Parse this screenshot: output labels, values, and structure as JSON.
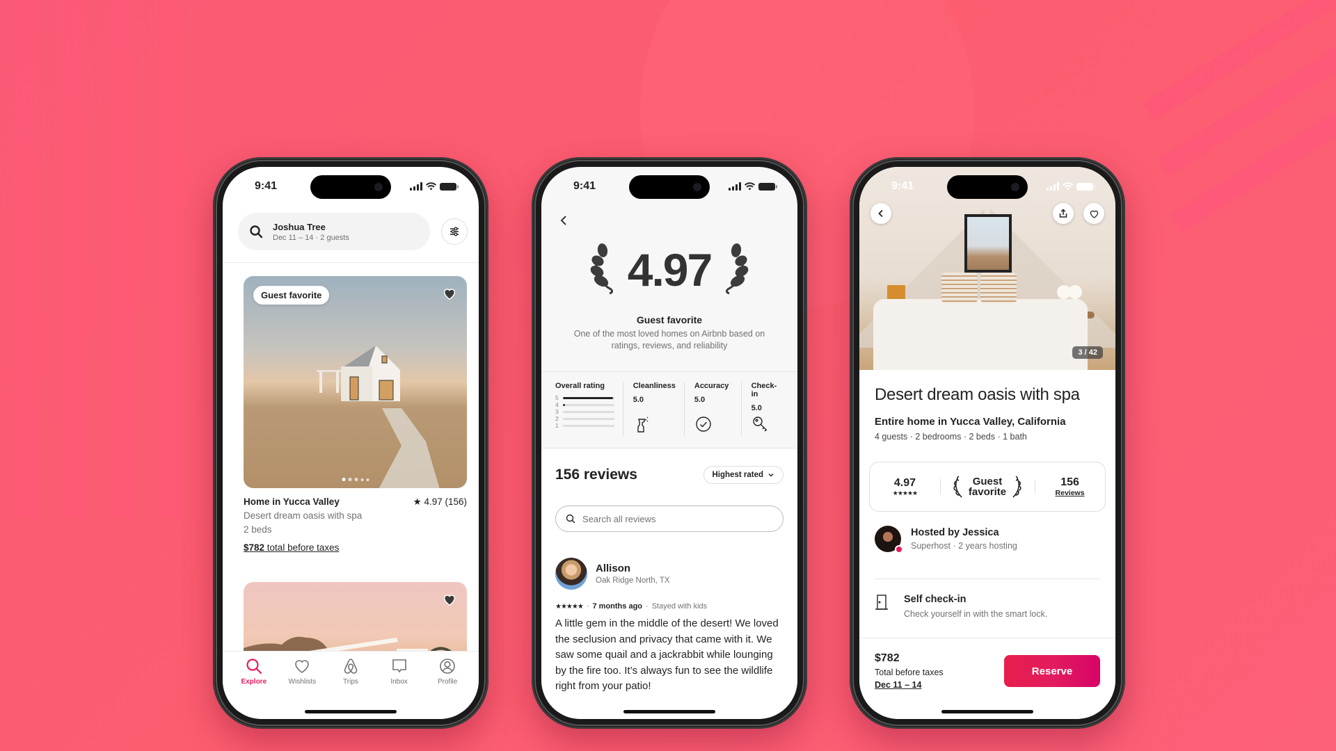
{
  "colors": {
    "brand": "#e31c5f",
    "background": "#fd5c73",
    "text": "#222222",
    "muted": "#717171"
  },
  "phones": {
    "explore": {
      "status_time": "9:41",
      "search": {
        "location": "Joshua Tree",
        "details": "Dec 11 – 14 · 2 guests"
      },
      "listings": [
        {
          "badge": "Guest favorite",
          "title": "Home in Yucca Valley",
          "rating": "★ 4.97 (156)",
          "description": "Desert dream oasis with spa",
          "beds": "2 beds",
          "price": "$782",
          "price_suffix": " total before taxes",
          "photo_index": 1,
          "photo_dots": 5,
          "favorited": true
        },
        {
          "favorited": true
        }
      ],
      "tabs": [
        {
          "label": "Explore",
          "icon": "search-icon",
          "active": true
        },
        {
          "label": "Wishlists",
          "icon": "heart-icon",
          "active": false
        },
        {
          "label": "Trips",
          "icon": "airbnb-logo-icon",
          "active": false
        },
        {
          "label": "Inbox",
          "icon": "message-icon",
          "active": false
        },
        {
          "label": "Profile",
          "icon": "profile-icon",
          "active": false
        }
      ]
    },
    "reviews": {
      "status_time": "9:41",
      "rating": "4.97",
      "guest_favorite_title": "Guest favorite",
      "guest_favorite_desc": "One of the most loved homes on Airbnb based on ratings, reviews, and reliability",
      "overall": {
        "label": "Overall rating",
        "distribution": [
          {
            "stars": "5",
            "fraction": 0.97
          },
          {
            "stars": "4",
            "fraction": 0.03
          },
          {
            "stars": "3",
            "fraction": 0
          },
          {
            "stars": "2",
            "fraction": 0
          },
          {
            "stars": "1",
            "fraction": 0
          }
        ]
      },
      "categories": [
        {
          "name": "Cleanliness",
          "value": "5.0",
          "icon": "spray-bottle-icon"
        },
        {
          "name": "Accuracy",
          "value": "5.0",
          "icon": "check-circle-icon"
        },
        {
          "name": "Check-in",
          "value": "5.0",
          "icon": "key-icon"
        }
      ],
      "reviews_count": "156 reviews",
      "sort_label": "Highest rated",
      "search_placeholder": "Search all reviews",
      "review": {
        "name": "Allison",
        "location": "Oak Ridge North, TX",
        "stars": "★★★★★",
        "when": "7 months ago",
        "context": "Stayed with kids",
        "text": "A little gem in the middle of the desert! We loved the seclusion and privacy that came with it. We saw some quail and a jackrabbit while lounging by the fire too. It’s always fun to see the wildlife right from your patio!"
      }
    },
    "listing": {
      "status_time": "9:41",
      "photo_counter": "3 / 42",
      "title": "Desert dream oasis with spa",
      "subtitle": "Entire home in Yucca Valley, California",
      "specs": "4 guests · 2 bedrooms · 2 beds · 1 bath",
      "stats": {
        "rating": "4.97",
        "stars": "★★★★★",
        "guest_favorite_line1": "Guest",
        "guest_favorite_line2": "favorite",
        "reviews_count": "156",
        "reviews_label": "Reviews"
      },
      "host": {
        "title": "Hosted by Jessica",
        "subtitle": "Superhost · 2 years hosting"
      },
      "feature": {
        "title": "Self check-in",
        "subtitle": "Check yourself in with the smart lock."
      },
      "footer": {
        "price": "$782",
        "price_label": "Total before taxes",
        "dates": "Dec 11 – 14",
        "reserve_label": "Reserve"
      }
    }
  }
}
